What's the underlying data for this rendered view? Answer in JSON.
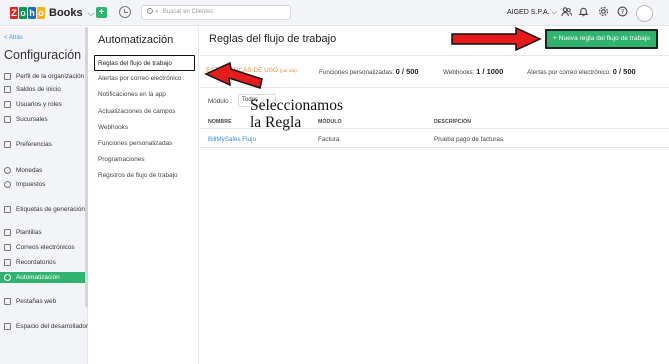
{
  "topbar": {
    "logo_letters": [
      "Z",
      "o",
      "h",
      "o"
    ],
    "logo_colors": [
      "#e42527",
      "#089949",
      "#226db4",
      "#f9b21d"
    ],
    "logo_text": "Books",
    "search_placeholder": "Buscar en Clientes",
    "org_name": "AIGED S.P.A.",
    "icons": [
      "chevron-down-icon",
      "people-icon",
      "bell-icon",
      "gear-icon",
      "help-icon",
      "avatar"
    ]
  },
  "sidebar": {
    "back": "< Atrás",
    "title": "Configuración",
    "items": [
      {
        "label": "Perfil de la organización",
        "icon": "building-icon"
      },
      {
        "label": "Saldos de inicio",
        "icon": "ledger-icon"
      },
      {
        "label": "Usuarios y roles",
        "icon": "users-icon"
      },
      {
        "label": "Sucursales",
        "icon": "branch-icon"
      },
      {
        "label": "Preferencias",
        "icon": "preferences-icon"
      },
      {
        "label": "Monedas",
        "icon": "currency-icon"
      },
      {
        "label": "Impuestos",
        "icon": "tax-icon"
      },
      {
        "label": "Etiquetas de generación",
        "icon": "tag-icon"
      },
      {
        "label": "Plantillas",
        "icon": "template-icon"
      },
      {
        "label": "Correos electrónicos",
        "icon": "mail-icon"
      },
      {
        "label": "Recordatorios",
        "icon": "reminder-icon"
      },
      {
        "label": "Automatización",
        "icon": "automation-icon",
        "active": true
      },
      {
        "label": "Pestañas web",
        "icon": "web-tab-icon"
      },
      {
        "label": "Espacio del desarrollador",
        "icon": "code-icon"
      }
    ]
  },
  "automation_menu": {
    "title": "Automatización",
    "items": [
      "Reglas del flujo de trabajo",
      "Alertas por correo electrónico",
      "Notificaciones en la app",
      "Actualizaciones de campos",
      "Webhooks",
      "Funciones personalizadas",
      "Programaciones",
      "Registros de flujo de trabajo"
    ],
    "active_index": 0
  },
  "main": {
    "title": "Reglas del flujo de trabajo",
    "new_button": "+ Nueva regla del flujo de trabajo",
    "usage_label": "ESTADÍSTICAS DE USO",
    "usage_period": "(por día)",
    "stats": [
      {
        "label": "Funciones personalizadas:",
        "value": "0 / 500"
      },
      {
        "label": "Webhooks:",
        "value": "1 / 1000"
      },
      {
        "label": "Alertas por correo electrónico:",
        "value": "0 / 500"
      }
    ],
    "module_label": "Módulo :",
    "module_value": "Todos",
    "columns": [
      "NOMBRE",
      "MÓDULO",
      "DESCRIPCIÓN"
    ],
    "rows": [
      {
        "name": "BillMySales Flujo",
        "module": "Factura",
        "description": "Prueba pago de facturas"
      }
    ]
  },
  "annotation": {
    "line1": "Seleccionamos",
    "line2": "la Regla"
  },
  "colors": {
    "accent": "#2fb36f",
    "link": "#3b8fe0",
    "usage": "#f08a3e",
    "arrow": "#e81b1b"
  }
}
